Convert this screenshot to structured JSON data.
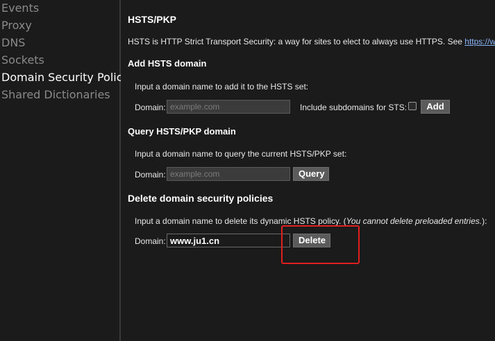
{
  "sidebar": {
    "items": [
      {
        "label": "Events"
      },
      {
        "label": "Proxy"
      },
      {
        "label": "DNS"
      },
      {
        "label": "Sockets"
      },
      {
        "label": "Domain Security Policy"
      },
      {
        "label": "Shared Dictionaries"
      }
    ],
    "active_item": "Domain Security Policy"
  },
  "main": {
    "title": "HSTS/PKP",
    "intro_text": "HSTS is HTTP Strict Transport Security: a way for sites to elect to always use HTTPS. See ",
    "intro_link": "https://www.",
    "add_section": {
      "heading": "Add HSTS domain",
      "description": "Input a domain name to add it to the HSTS set:",
      "domain_label": "Domain:",
      "domain_placeholder": "example.com",
      "subdomains_label": "Include subdomains for STS:",
      "button_label": "Add"
    },
    "query_section": {
      "heading": "Query HSTS/PKP domain",
      "description": "Input a domain name to query the current HSTS/PKP set:",
      "domain_label": "Domain:",
      "domain_placeholder": "example.com",
      "button_label": "Query"
    },
    "delete_section": {
      "heading": "Delete domain security policies",
      "description": "Input a domain name to delete its dynamic HSTS policy. (",
      "description_italic": "You cannot delete preloaded entries.",
      "description_end": "):",
      "domain_label": "Domain:",
      "domain_value": "www.ju1.cn",
      "button_label": "Delete"
    }
  },
  "colors": {
    "background": "#1b1b1b",
    "link": "#8ab4f8",
    "highlight": "#e02020",
    "button": "#5b5b5b"
  }
}
